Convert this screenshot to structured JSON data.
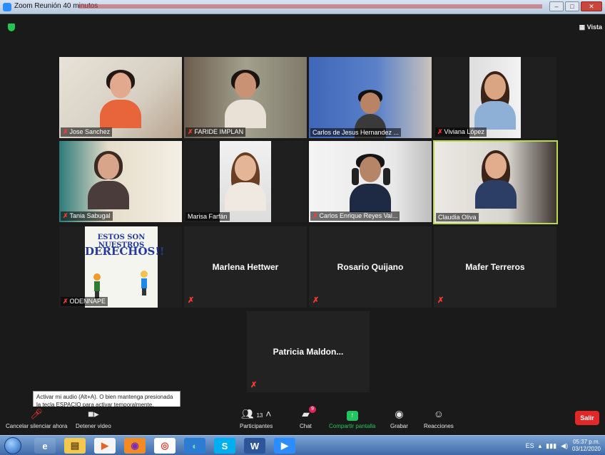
{
  "window": {
    "title": "Zoom Reunión 40 minutos",
    "minimize": "–",
    "maximize": "□",
    "close": "✕"
  },
  "header": {
    "view_label": "▦ Vista"
  },
  "participants": [
    {
      "name": "Jose Sanchez",
      "muted": true,
      "video": true
    },
    {
      "name": "FARIDE IMPLAN",
      "muted": true,
      "video": true
    },
    {
      "name": "Carlos de Jesus Hernandez ...",
      "muted": false,
      "video": true
    },
    {
      "name": "Viviana López",
      "muted": true,
      "video": true
    },
    {
      "name": "Tania Sabugal",
      "muted": true,
      "video": true
    },
    {
      "name": "Marisa Farfán",
      "muted": false,
      "video": true
    },
    {
      "name": "Carlos Enrique Reyes Val...",
      "muted": true,
      "video": true
    },
    {
      "name": "Claudia Oliva",
      "muted": false,
      "video": true,
      "active_speaker": true
    },
    {
      "name": "ODENNAPE",
      "muted": true,
      "video": true
    },
    {
      "name": "Marlena Hettwer",
      "muted": true,
      "video": false
    },
    {
      "name": "Rosario Quijano",
      "muted": true,
      "video": false
    },
    {
      "name": "Mafer Terreros",
      "muted": true,
      "video": false
    },
    {
      "name": "Patricia Maldon...",
      "muted": true,
      "video": false
    }
  ],
  "shared_sign": {
    "line1": "ESTOS SON NUESTROS",
    "line2": "DERECHOS!!"
  },
  "tooltip": {
    "text": "Activar mi audio (Alt+A). O bien mantenga presionada la tecla ESPACIO para activar temporalmente."
  },
  "toolbar": {
    "unmute_label": "Cancelar silenciar ahora",
    "video_label": "Detener video",
    "participants_label": "Participantes",
    "participants_count": "13",
    "chat_label": "Chat",
    "chat_badge": "9",
    "share_label": "Compartir pantalla",
    "record_label": "Grabar",
    "reactions_label": "Reacciones",
    "leave_label": "Salir"
  },
  "taskbar": {
    "language": "ES",
    "time": "05:37 p.m.",
    "date": "03/12/2020"
  },
  "colors": {
    "zoom_blue": "#2d8cff",
    "muted_red": "#ff3b30",
    "share_green": "#22c55e",
    "leave_red": "#e02828",
    "active_border": "#b9d94a"
  }
}
